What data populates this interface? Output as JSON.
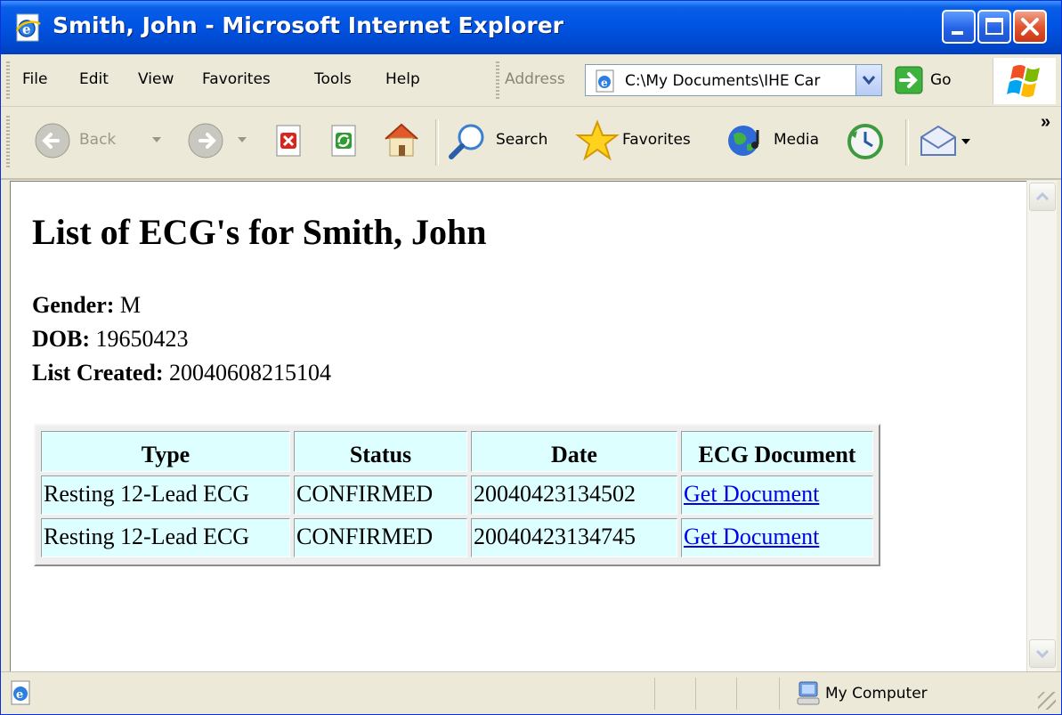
{
  "window": {
    "title": "Smith, John - Microsoft Internet Explorer"
  },
  "menubar": {
    "items": [
      {
        "label": "File"
      },
      {
        "label": "Edit"
      },
      {
        "label": "View"
      },
      {
        "label": "Favorites"
      },
      {
        "label": "Tools"
      },
      {
        "label": "Help"
      }
    ],
    "address_label": "Address",
    "address_value": "C:\\My Documents\\IHE Car",
    "go_label": "Go"
  },
  "toolbar": {
    "back_label": "Back",
    "search_label": "Search",
    "favorites_label": "Favorites",
    "media_label": "Media",
    "overflow": "»"
  },
  "page": {
    "title": "List of ECG's for Smith, John",
    "gender_label": "Gender:",
    "gender_value": "M",
    "dob_label": "DOB:",
    "dob_value": "19650423",
    "created_label": "List Created:",
    "created_value": "20040608215104"
  },
  "table": {
    "headers": [
      "Type",
      "Status",
      "Date",
      "ECG Document"
    ],
    "rows": [
      [
        "Resting 12-Lead ECG",
        "CONFIRMED",
        "20040423134502",
        "Get Document"
      ],
      [
        "Resting 12-Lead ECG",
        "CONFIRMED",
        "20040423134745",
        "Get Document"
      ]
    ]
  },
  "statusbar": {
    "zone": "My Computer"
  },
  "colors": {
    "titlebar": "#0054e3",
    "cell_bg": "#ddffff",
    "link": "#0000ee",
    "chrome": "#ece9d8"
  }
}
